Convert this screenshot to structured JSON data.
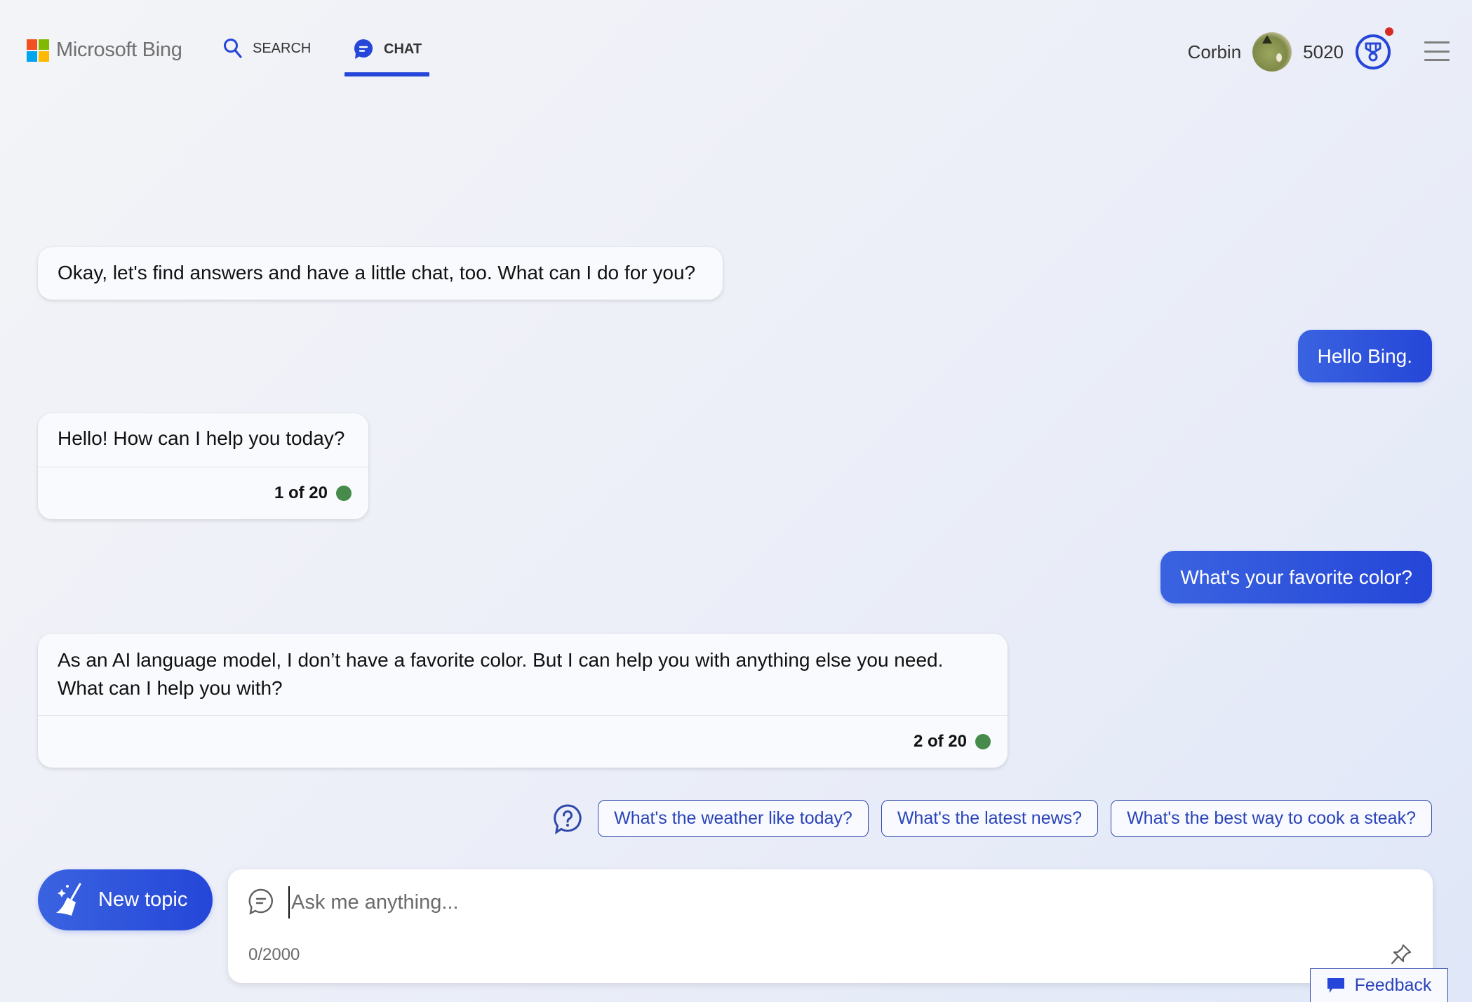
{
  "header": {
    "logo_text": "Microsoft Bing",
    "logo_colors": [
      "#f25022",
      "#7fba00",
      "#00a4ef",
      "#ffb900"
    ],
    "tabs": [
      {
        "label": "SEARCH",
        "icon": "search-icon",
        "active": false
      },
      {
        "label": "CHAT",
        "icon": "chat-icon",
        "active": true
      }
    ],
    "user_name": "Corbin",
    "points": "5020",
    "rewards_notification": true
  },
  "conversation": {
    "messages": [
      {
        "role": "bot",
        "text": "Okay, let's find answers and have a little chat, too. What can I do for you?"
      },
      {
        "role": "user",
        "text": "Hello Bing."
      },
      {
        "role": "bot",
        "text": "Hello! How can I help you today?",
        "counter": "1 of 20"
      },
      {
        "role": "user",
        "text": "What's your favorite color?"
      },
      {
        "role": "bot",
        "text": "As an AI language model, I don’t have a favorite color. But I can help you with anything else you need. What can I help you with?",
        "counter": "2 of 20"
      }
    ]
  },
  "suggestions": [
    "What's the weather like today?",
    "What's the latest news?",
    "What's the best way to cook a steak?"
  ],
  "composer": {
    "new_topic_label": "New topic",
    "placeholder": "Ask me anything...",
    "value": "",
    "char_count": "0/2000"
  },
  "feedback_label": "Feedback",
  "colors": {
    "accent": "#2546d8",
    "status_green": "#468a4c",
    "notification_red": "#d62b25"
  }
}
